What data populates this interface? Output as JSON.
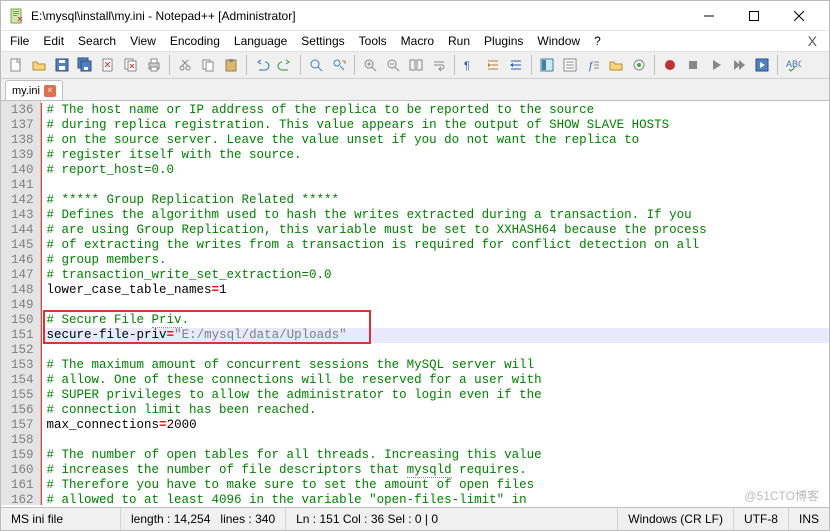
{
  "window": {
    "title": "E:\\mysql\\install\\my.ini - Notepad++ [Administrator]"
  },
  "menu": {
    "file": "File",
    "edit": "Edit",
    "search": "Search",
    "view": "View",
    "encoding": "Encoding",
    "language": "Language",
    "settings": "Settings",
    "tools": "Tools",
    "macro": "Macro",
    "run": "Run",
    "plugins": "Plugins",
    "window": "Window",
    "help": "?",
    "closex": "X"
  },
  "tabs": {
    "t0": "my.ini"
  },
  "gutter": {
    "l136": "136",
    "l137": "137",
    "l138": "138",
    "l139": "139",
    "l140": "140",
    "l141": "141",
    "l142": "142",
    "l143": "143",
    "l144": "144",
    "l145": "145",
    "l146": "146",
    "l147": "147",
    "l148": "148",
    "l149": "149",
    "l150": "150",
    "l151": "151",
    "l152": "152",
    "l153": "153",
    "l154": "154",
    "l155": "155",
    "l156": "156",
    "l157": "157",
    "l158": "158",
    "l159": "159",
    "l160": "160",
    "l161": "161",
    "l162": "162"
  },
  "code": {
    "l136": "# The host name or IP address of the replica to be reported to the source",
    "l137": "# during replica registration. This value appears in the output of SHOW SLAVE HOSTS",
    "l138": "# on the source server. Leave the value unset if you do not want the replica to",
    "l139": "# register itself with the source.",
    "l140": "# report_host=0.0",
    "l142": "# ***** Group Replication Related *****",
    "l143": "# Defines the algorithm used to hash the writes extracted during a transaction. If you",
    "l144": "# are using Group Replication, this variable must be set to XXHASH64 because the process",
    "l145": "# of extracting the writes from a transaction is required for conflict detection on all",
    "l146": "# group members.",
    "l147": "# transaction_write_set_extraction=0.0",
    "l148_key": "lower_case_table_names",
    "l148_eq": "=",
    "l148_val": "1",
    "l150": "# Secure File ",
    "l150_priv": "Priv",
    "l150_dot": ".",
    "l151_key": "secure-file-priv",
    "l151_eq": "=",
    "l151_val": "\"E:/mysql/data/Uploads\"",
    "l153": "# The maximum amount of concurrent sessions the MySQL server will",
    "l154": "# allow. One of these connections will be reserved for a user with",
    "l155": "# SUPER privileges to allow the administrator to login even if the",
    "l156": "# connection limit has been reached.",
    "l157_key": "max_connections",
    "l157_eq": "=",
    "l157_val": "2000",
    "l159": "# The number of open tables for all threads. Increasing this value",
    "l160_a": "# increases the number of file descriptors that ",
    "l160_b": "mysqld",
    "l160_c": " requires.",
    "l161": "# Therefore you have to make sure to set the amount of open files",
    "l162": "# allowed to at least 4096 in the variable \"open-files-limit\" in"
  },
  "status": {
    "filetype": "MS ini file",
    "length": "length : 14,254",
    "lines": "lines : 340",
    "pos": "Ln : 151   Col : 36   Sel : 0 | 0",
    "eol": "Windows (CR LF)",
    "enc": "UTF-8",
    "ins": "INS"
  },
  "watermark": "@51CTO博客"
}
